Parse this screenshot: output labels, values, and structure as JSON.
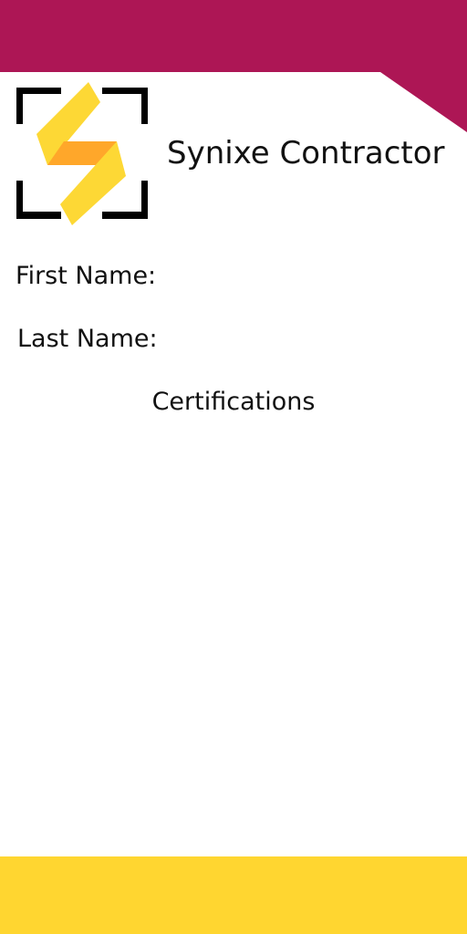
{
  "brand": {
    "title": "Synixe Contractor",
    "logo_icon": "synixe-s-logo-icon"
  },
  "fields": {
    "first_name_label": "First Name:",
    "last_name_label": "Last Name:"
  },
  "sections": {
    "certifications_heading": "Certifications"
  },
  "colors": {
    "header_band": "#AD1655",
    "footer_band": "#FFD630",
    "logo_yellow": "#FDD835",
    "logo_orange": "#FFA72A",
    "logo_frame": "#000000"
  }
}
